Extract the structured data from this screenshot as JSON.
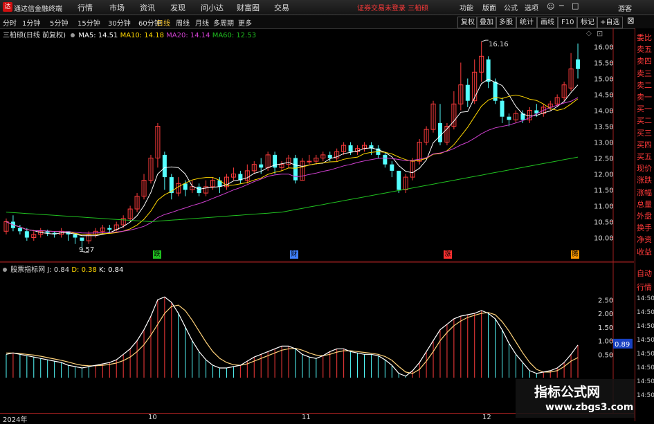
{
  "app": {
    "title": "通达信金融终端",
    "logo": "达"
  },
  "menu": {
    "items": [
      "行情",
      "市场",
      "资讯",
      "发现",
      "问小达",
      "财富圈",
      "交易"
    ],
    "alert": "证券交易未登录  三柏硕",
    "right": [
      "功能",
      "版面",
      "公式",
      "选项"
    ],
    "login": "游客"
  },
  "periods": [
    "分时",
    "1分钟",
    "5分钟",
    "15分钟",
    "30分钟",
    "60分钟",
    "日线",
    "周线",
    "月线",
    "多周期",
    "更多"
  ],
  "active_period": "日线",
  "tools": [
    "复权",
    "叠加",
    "多股",
    "统计",
    "画线",
    "F10",
    "标记",
    "+自选"
  ],
  "legend_main": {
    "stock": "三柏硕(日线 前复权)",
    "ma5": "MA5: 14.51",
    "ma10": "MA10: 14.18",
    "ma20": "MA20: 14.14",
    "ma60": "MA60: 12.53",
    "ma5_color": "#ffffff",
    "ma10_color": "#ffd700",
    "ma20_color": "#d040d0",
    "ma60_color": "#20c020"
  },
  "legend_sub": {
    "name": "股票指标网",
    "j": "J: 0.84",
    "d": "D: 0.38",
    "k": "K: 0.84"
  },
  "annotations": {
    "high": "16.16",
    "low": "9.57"
  },
  "markers": [
    {
      "text": "跌",
      "color": "#20c020"
    },
    {
      "text": "财",
      "color": "#4080ff"
    },
    {
      "text": "涨",
      "color": "#ff3030"
    },
    {
      "text": "腾",
      "color": "#ff9900"
    }
  ],
  "right_panel": {
    "quote": [
      "委比",
      "卖五",
      "卖四",
      "卖三",
      "卖二",
      "卖一",
      "买一",
      "买二",
      "买三",
      "买四",
      "买五",
      "现价",
      "涨跌",
      "涨幅",
      "总量",
      "外盘",
      "换手",
      "净资",
      "收益"
    ],
    "sub": [
      "自动",
      "行情",
      "14:50",
      "14:50",
      "14:50",
      "14:50",
      "14:50",
      "14:50",
      "14:50",
      "14:50"
    ]
  },
  "sub_price_tag": "0.89",
  "xaxis": [
    "2024年",
    "10",
    "11",
    "12"
  ],
  "watermark": {
    "line1": "指标公式网",
    "line2": "www.zbgs3.com"
  },
  "chart_data": [
    {
      "type": "candlestick",
      "title": "",
      "y_ticks": [
        10.0,
        10.5,
        11.0,
        11.5,
        12.0,
        12.5,
        13.0,
        13.5,
        14.0,
        14.5,
        15.0,
        15.5,
        16.0
      ],
      "ylim": [
        9.5,
        16.5
      ],
      "candles": [
        [
          10.2,
          10.5,
          10.1,
          10.6
        ],
        [
          10.5,
          10.3,
          10.2,
          10.7
        ],
        [
          10.3,
          10.2,
          10.1,
          10.4
        ],
        [
          10.2,
          10.0,
          9.9,
          10.3
        ],
        [
          10.0,
          10.1,
          9.9,
          10.2
        ],
        [
          10.1,
          10.2,
          10.0,
          10.3
        ],
        [
          10.2,
          10.15,
          10.05,
          10.25
        ],
        [
          10.15,
          10.1,
          10.0,
          10.2
        ],
        [
          10.1,
          10.2,
          10.0,
          10.3
        ],
        [
          10.2,
          10.1,
          9.9,
          10.2
        ],
        [
          10.1,
          10.0,
          9.8,
          10.1
        ],
        [
          10.0,
          9.9,
          9.57,
          10.0
        ],
        [
          9.9,
          10.1,
          9.8,
          10.2
        ],
        [
          10.1,
          10.2,
          10.0,
          10.3
        ],
        [
          10.2,
          10.3,
          10.1,
          10.4
        ],
        [
          10.3,
          10.25,
          10.15,
          10.4
        ],
        [
          10.25,
          10.4,
          10.2,
          10.5
        ],
        [
          10.4,
          10.6,
          10.3,
          10.7
        ],
        [
          10.6,
          10.9,
          10.5,
          11.0
        ],
        [
          10.9,
          11.3,
          10.8,
          11.4
        ],
        [
          11.3,
          11.8,
          11.2,
          12.0
        ],
        [
          11.8,
          12.5,
          11.7,
          12.6
        ],
        [
          12.5,
          13.5,
          12.2,
          13.6
        ],
        [
          12.6,
          11.9,
          11.5,
          12.7
        ],
        [
          11.9,
          11.4,
          11.2,
          12.0
        ],
        [
          11.4,
          11.7,
          11.3,
          11.9
        ],
        [
          11.7,
          11.5,
          11.3,
          11.8
        ],
        [
          11.5,
          11.6,
          11.4,
          11.8
        ],
        [
          11.6,
          11.4,
          11.3,
          11.7
        ],
        [
          11.4,
          11.6,
          11.3,
          11.8
        ],
        [
          11.6,
          11.8,
          11.5,
          11.9
        ],
        [
          11.8,
          11.6,
          11.4,
          11.9
        ],
        [
          11.6,
          11.9,
          11.5,
          12.0
        ],
        [
          11.9,
          12.0,
          11.8,
          12.2
        ],
        [
          12.0,
          11.8,
          11.7,
          12.1
        ],
        [
          11.8,
          12.1,
          11.7,
          12.3
        ],
        [
          12.1,
          12.3,
          12.0,
          12.4
        ],
        [
          12.3,
          12.2,
          12.0,
          12.5
        ],
        [
          12.2,
          12.6,
          12.1,
          12.7
        ],
        [
          12.6,
          12.2,
          12.0,
          12.7
        ],
        [
          12.2,
          12.3,
          12.1,
          12.4
        ],
        [
          12.3,
          12.5,
          12.2,
          12.6
        ],
        [
          12.5,
          11.8,
          11.7,
          12.6
        ],
        [
          11.8,
          12.4,
          11.8,
          12.5
        ],
        [
          12.4,
          12.4,
          12.3,
          12.6
        ],
        [
          12.4,
          12.5,
          12.3,
          12.6
        ],
        [
          12.5,
          12.6,
          12.4,
          12.7
        ],
        [
          12.6,
          12.5,
          12.4,
          12.7
        ],
        [
          12.5,
          12.7,
          12.4,
          12.8
        ],
        [
          12.7,
          12.9,
          12.6,
          13.0
        ],
        [
          12.9,
          12.7,
          12.6,
          13.0
        ],
        [
          12.7,
          12.8,
          12.6,
          12.9
        ],
        [
          12.8,
          12.9,
          12.7,
          13.0
        ],
        [
          12.9,
          12.8,
          12.6,
          13.0
        ],
        [
          12.8,
          12.6,
          12.5,
          12.9
        ],
        [
          12.6,
          12.3,
          12.2,
          12.7
        ],
        [
          12.3,
          12.1,
          11.9,
          12.4
        ],
        [
          12.1,
          11.5,
          11.4,
          12.1
        ],
        [
          11.5,
          11.9,
          11.4,
          12.0
        ],
        [
          11.9,
          12.4,
          11.8,
          12.5
        ],
        [
          12.4,
          13.0,
          12.3,
          13.1
        ],
        [
          13.0,
          13.4,
          12.9,
          13.5
        ],
        [
          13.4,
          14.2,
          13.3,
          14.3
        ],
        [
          13.6,
          13.0,
          12.9,
          14.2
        ],
        [
          13.0,
          13.5,
          12.9,
          13.6
        ],
        [
          13.5,
          14.2,
          13.4,
          14.6
        ],
        [
          14.2,
          14.8,
          14.0,
          15.5
        ],
        [
          14.8,
          14.3,
          14.1,
          15.0
        ],
        [
          14.3,
          15.2,
          14.2,
          15.6
        ],
        [
          15.2,
          15.7,
          14.9,
          16.16
        ],
        [
          15.6,
          14.9,
          14.7,
          15.7
        ],
        [
          14.9,
          14.3,
          14.2,
          15.0
        ],
        [
          14.3,
          13.8,
          13.6,
          14.4
        ],
        [
          13.8,
          13.7,
          13.5,
          13.9
        ],
        [
          13.7,
          13.9,
          13.6,
          14.0
        ],
        [
          13.9,
          13.7,
          13.6,
          14.0
        ],
        [
          13.7,
          14.0,
          13.6,
          14.1
        ],
        [
          14.0,
          13.9,
          13.8,
          14.2
        ],
        [
          13.9,
          14.1,
          13.8,
          14.2
        ],
        [
          14.1,
          14.2,
          14.0,
          14.3
        ],
        [
          14.2,
          14.4,
          14.1,
          14.5
        ],
        [
          14.4,
          14.8,
          14.3,
          14.9
        ],
        [
          14.7,
          15.3,
          14.6,
          15.8
        ],
        [
          15.6,
          15.3,
          15.0,
          16.1
        ]
      ],
      "ma60": [
        [
          0,
          10.8
        ],
        [
          21,
          10.5
        ],
        [
          40,
          10.8
        ],
        [
          60,
          11.6
        ],
        [
          83,
          12.53
        ]
      ]
    },
    {
      "type": "line",
      "title": "",
      "series_names": [
        "K",
        "D",
        "J"
      ],
      "y_ticks": [
        0.5,
        1.0,
        1.5,
        2.0,
        2.5
      ],
      "ylim": [
        -0.5,
        3.0
      ],
      "k": [
        0.5,
        0.55,
        0.5,
        0.45,
        0.4,
        0.35,
        0.3,
        0.25,
        0.2,
        0.1,
        0.05,
        0.0,
        0.05,
        0.1,
        0.15,
        0.2,
        0.3,
        0.5,
        0.7,
        1.0,
        1.4,
        1.9,
        2.5,
        2.6,
        2.4,
        2.0,
        1.5,
        1.0,
        0.6,
        0.3,
        0.1,
        0.0,
        0.0,
        0.05,
        0.1,
        0.25,
        0.4,
        0.5,
        0.6,
        0.7,
        0.8,
        0.8,
        0.7,
        0.5,
        0.4,
        0.35,
        0.45,
        0.6,
        0.7,
        0.7,
        0.6,
        0.55,
        0.5,
        0.5,
        0.45,
        0.3,
        0.1,
        -0.2,
        -0.3,
        -0.1,
        0.2,
        0.6,
        1.0,
        1.4,
        1.6,
        1.8,
        1.9,
        1.95,
        2.0,
        2.1,
        2.0,
        1.8,
        1.4,
        0.9,
        0.5,
        0.2,
        -0.1,
        -0.2,
        -0.15,
        -0.1,
        0.0,
        0.2,
        0.5,
        0.84
      ],
      "d": [
        0.55,
        0.55,
        0.53,
        0.5,
        0.47,
        0.43,
        0.38,
        0.33,
        0.28,
        0.22,
        0.15,
        0.1,
        0.08,
        0.08,
        0.1,
        0.13,
        0.18,
        0.27,
        0.4,
        0.6,
        0.85,
        1.2,
        1.6,
        2.0,
        2.25,
        2.3,
        2.1,
        1.75,
        1.35,
        0.95,
        0.6,
        0.35,
        0.2,
        0.12,
        0.1,
        0.15,
        0.25,
        0.35,
        0.45,
        0.55,
        0.65,
        0.7,
        0.72,
        0.65,
        0.55,
        0.47,
        0.45,
        0.5,
        0.58,
        0.63,
        0.63,
        0.6,
        0.57,
        0.54,
        0.5,
        0.42,
        0.28,
        0.05,
        -0.15,
        -0.2,
        -0.05,
        0.25,
        0.6,
        1.0,
        1.3,
        1.55,
        1.72,
        1.85,
        1.93,
        2.0,
        2.03,
        1.95,
        1.7,
        1.35,
        0.95,
        0.55,
        0.2,
        -0.05,
        -0.15,
        -0.15,
        -0.1,
        0.05,
        0.25,
        0.38
      ]
    }
  ]
}
